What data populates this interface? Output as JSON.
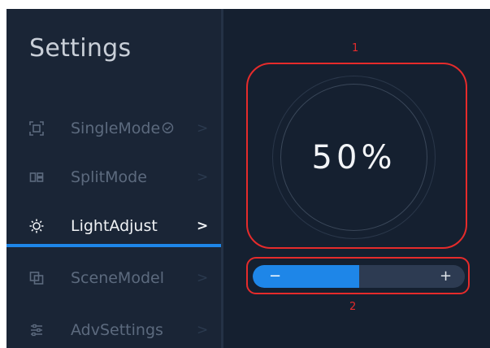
{
  "sidebar": {
    "title": "Settings",
    "items": [
      {
        "label": "SingleMode",
        "icon": "single-mode-icon",
        "active": false,
        "badge_icon": "check-circle-icon",
        "chevron": ">"
      },
      {
        "label": "SplitMode",
        "icon": "split-mode-icon",
        "active": false,
        "chevron": ">"
      },
      {
        "label": "LightAdjust",
        "icon": "light-adjust-icon",
        "active": true,
        "chevron": ">"
      },
      {
        "label": "SceneModel",
        "icon": "scene-model-icon",
        "active": false,
        "chevron": ">"
      },
      {
        "label": "AdvSettings",
        "icon": "adv-settings-icon",
        "active": false,
        "chevron": ">"
      }
    ]
  },
  "main": {
    "brightness_display": "50%",
    "brightness_level": 0.5,
    "slider": {
      "minus_label": "−",
      "plus_label": "+",
      "level": 0.5
    }
  },
  "annotations": {
    "label_1": "1",
    "label_2": "2"
  },
  "colors": {
    "accent": "#1e86e8",
    "background": "#152030",
    "annotation": "#e62b2b"
  }
}
